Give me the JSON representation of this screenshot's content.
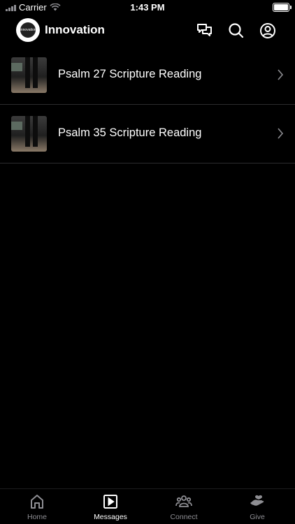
{
  "status_bar": {
    "carrier": "Carrier",
    "time": "1:43 PM"
  },
  "header": {
    "title": "Innovation",
    "logo_text": "Innovation"
  },
  "items": [
    {
      "title": "Psalm 27 Scripture Reading"
    },
    {
      "title": "Psalm 35 Scripture Reading"
    }
  ],
  "tabs": [
    {
      "label": "Home",
      "icon": "home-icon",
      "active": false
    },
    {
      "label": "Messages",
      "icon": "play-square-icon",
      "active": true
    },
    {
      "label": "Connect",
      "icon": "people-icon",
      "active": false
    },
    {
      "label": "Give",
      "icon": "hand-icon",
      "active": false
    }
  ],
  "colors": {
    "background": "#000000",
    "text": "#ffffff",
    "inactive": "#8e8e93",
    "divider": "#2c2c2e"
  }
}
